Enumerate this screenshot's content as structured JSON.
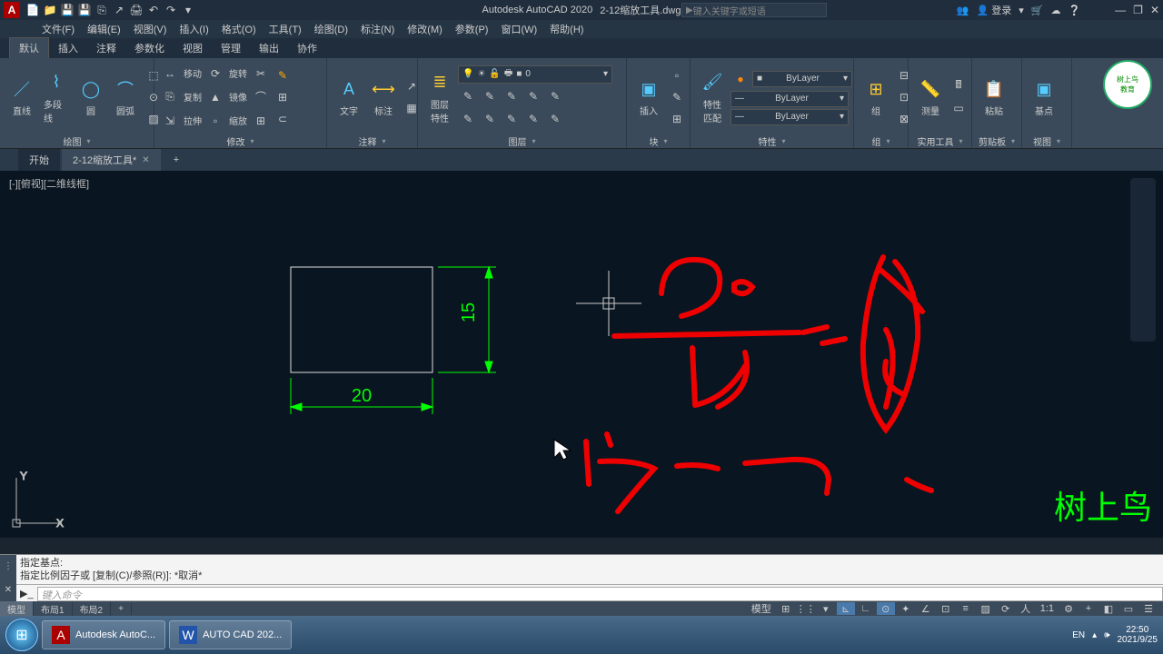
{
  "app": {
    "letter": "A",
    "title_vendor": "Autodesk AutoCAD 2020",
    "title_file": "2-12缩放工具.dwg",
    "search_placeholder": "键入关键字或短语",
    "login": "登录"
  },
  "qat": [
    "📄",
    "📁",
    "💾",
    "💾",
    "⎘",
    "↗",
    "🖨",
    "↶",
    "↷",
    "▾"
  ],
  "menus": [
    "文件(F)",
    "编辑(E)",
    "视图(V)",
    "插入(I)",
    "格式(O)",
    "工具(T)",
    "绘图(D)",
    "标注(N)",
    "修改(M)",
    "参数(P)",
    "窗口(W)",
    "帮助(H)"
  ],
  "ribbon_tabs": [
    "默认",
    "插入",
    "注释",
    "参数化",
    "视图",
    "管理",
    "输出",
    "协作"
  ],
  "ribbon_active": 0,
  "panels": {
    "draw": {
      "title": "绘图",
      "items": [
        "直线",
        "多段线",
        "圆",
        "圆弧"
      ]
    },
    "modify": {
      "title": "修改",
      "rows": [
        [
          "移动",
          "旋转",
          "修剪"
        ],
        [
          "复制",
          "镜像",
          "圆角"
        ],
        [
          "拉伸",
          "缩放",
          "阵列"
        ]
      ],
      "row_icons": [
        [
          "↔",
          "⟳",
          "✂"
        ],
        [
          "⎘",
          "▲",
          "⌒"
        ],
        [
          "⇲",
          "▫",
          "⊞"
        ]
      ]
    },
    "annot": {
      "title": "注释",
      "text_btn": "文字",
      "dim_btn": "标注"
    },
    "layer": {
      "title": "图层",
      "prop_btn": "图层\n特性",
      "current": "0",
      "combo_icons": [
        "💡",
        "☀",
        "🔓",
        "🖶",
        "■"
      ]
    },
    "block": {
      "title": "块",
      "insert_btn": "插入"
    },
    "props": {
      "title": "特性",
      "match_btn": "特性\n匹配",
      "bylayer": "ByLayer"
    },
    "group": {
      "title": "组",
      "btn": "组"
    },
    "util": {
      "title": "实用工具",
      "btn": "测量"
    },
    "clip": {
      "title": "剪贴板",
      "btn": "粘贴"
    },
    "view": {
      "title": "视图",
      "btn": "基点"
    }
  },
  "doctabs": {
    "start": "开始",
    "file": "2-12缩放工具*",
    "plus": "+"
  },
  "viewport": {
    "corner_label": "[-][俯视][二维线框]",
    "dim_width": "20",
    "dim_height": "15",
    "axis_x": "X",
    "axis_y": "Y",
    "watermark": "树上鸟"
  },
  "cmdline": {
    "hist1": "指定基点:",
    "hist2": "指定比例因子或 [复制(C)/参照(R)]: *取消*",
    "prompt_placeholder": "键入命令"
  },
  "layout_tabs": [
    "模型",
    "布局1",
    "布局2",
    "+"
  ],
  "status": {
    "model": "模型",
    "scale": "1:1"
  },
  "taskbar": {
    "app1": "Autodesk AutoC...",
    "app2": "AUTO  CAD 202...",
    "lang": "EN",
    "time": "22:50",
    "date": "2021/9/25"
  }
}
